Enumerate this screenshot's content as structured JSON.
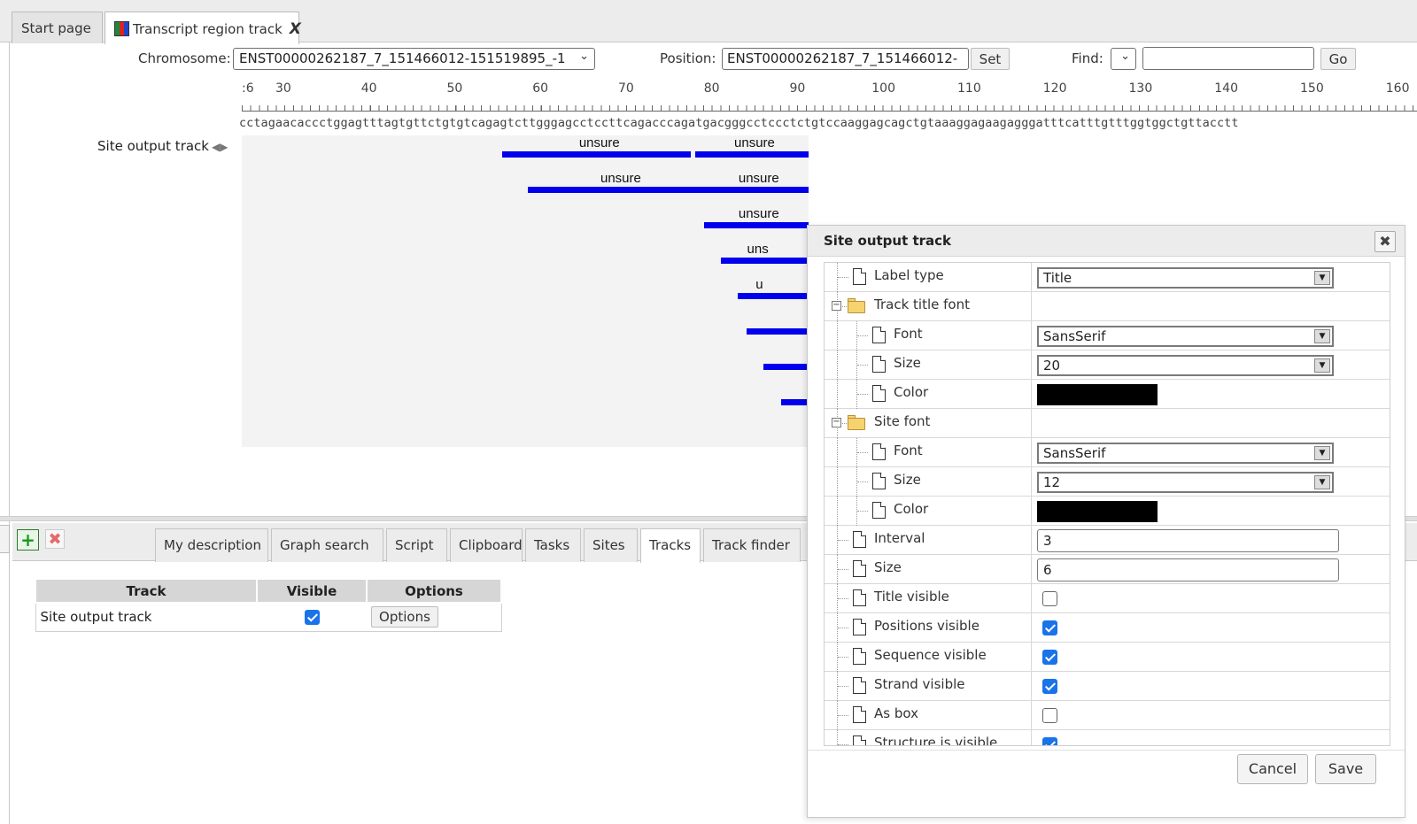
{
  "tabs": [
    {
      "label": "Start page"
    },
    {
      "label": "Transcript region track",
      "close": "X"
    }
  ],
  "toolbar": {
    "chromosome_label": "Chromosome:",
    "chromosome_value": "ENST00000262187_7_151466012-151519895_-1",
    "position_label": "Position:",
    "position_value": "ENST00000262187_7_151466012-",
    "set_label": "Set",
    "find_label": "Find:",
    "find_value": "",
    "go_label": "Go"
  },
  "ruler": {
    "ticks": [
      ":6",
      "30",
      "40",
      "50",
      "60",
      "70",
      "80",
      "90",
      "100",
      "110",
      "120",
      "130",
      "140",
      "150",
      "160"
    ],
    "sequence": "cctagaacaccctggagtttagtgttctgtgtcagagtcttgggagcctccttcagacccagatgacgggcctccctctgtccaaggagcagctgtaaaggagaagagggatttcatttgtttggtggctgttacctt"
  },
  "track": {
    "name": "Site output track",
    "sites": [
      {
        "label": "unsure",
        "start": 56.5,
        "end": 78.5
      },
      {
        "label": "unsure",
        "start": 79,
        "end": 99
      },
      {
        "label": "unsure",
        "start": 59.5,
        "end": 80.5
      },
      {
        "label": "unsure",
        "start": 80,
        "end": 100
      },
      {
        "label": "unsure",
        "start": 80,
        "end": 130
      },
      {
        "label": "uns",
        "start": 82,
        "end": 130
      },
      {
        "label": "u",
        "start": 84,
        "end": 130
      },
      {
        "label": "",
        "start": 85,
        "end": 130
      },
      {
        "label": "",
        "start": 87,
        "end": 130
      },
      {
        "label": "",
        "start": 89,
        "end": 130
      }
    ]
  },
  "bottom_tabs": [
    "My description",
    "Graph search",
    "Script",
    "Clipboard",
    "Tasks",
    "Sites",
    "Tracks",
    "Track finder"
  ],
  "active_bottom_tab": "Tracks",
  "tracks_table": {
    "headers": [
      "Track",
      "Visible",
      "Options"
    ],
    "rows": [
      {
        "track": "Site output track",
        "visible": true,
        "options": "Options"
      }
    ]
  },
  "dialog": {
    "title": "Site output track",
    "close_icon": "close-icon",
    "properties": [
      {
        "name": "Label type",
        "level": 0,
        "kind": "combo",
        "value": "Title"
      },
      {
        "name": "Track title font",
        "level": 0,
        "kind": "group"
      },
      {
        "name": "Font",
        "level": 1,
        "kind": "combo",
        "value": "SansSerif"
      },
      {
        "name": "Size",
        "level": 1,
        "kind": "combo",
        "value": "20"
      },
      {
        "name": "Color",
        "level": 1,
        "kind": "color",
        "value": "#000000"
      },
      {
        "name": "Site font",
        "level": 0,
        "kind": "group"
      },
      {
        "name": "Font",
        "level": 1,
        "kind": "combo",
        "value": "SansSerif"
      },
      {
        "name": "Size",
        "level": 1,
        "kind": "combo",
        "value": "12"
      },
      {
        "name": "Color",
        "level": 1,
        "kind": "color",
        "value": "#000000"
      },
      {
        "name": "Interval",
        "level": 0,
        "kind": "text",
        "value": "3"
      },
      {
        "name": "Size",
        "level": 0,
        "kind": "text",
        "value": "6"
      },
      {
        "name": "Title visible",
        "level": 0,
        "kind": "check",
        "value": false
      },
      {
        "name": "Positions visible",
        "level": 0,
        "kind": "check",
        "value": true
      },
      {
        "name": "Sequence visible",
        "level": 0,
        "kind": "check",
        "value": true
      },
      {
        "name": "Strand visible",
        "level": 0,
        "kind": "check",
        "value": true
      },
      {
        "name": "As box",
        "level": 0,
        "kind": "check",
        "value": false
      },
      {
        "name": "Structure is visible",
        "level": 0,
        "kind": "check",
        "value": true
      }
    ],
    "cancel_label": "Cancel",
    "save_label": "Save"
  },
  "colors": {
    "site_bar": "#0000ee",
    "checkbox": "#1a73e8",
    "folder": "#f6d36e"
  }
}
